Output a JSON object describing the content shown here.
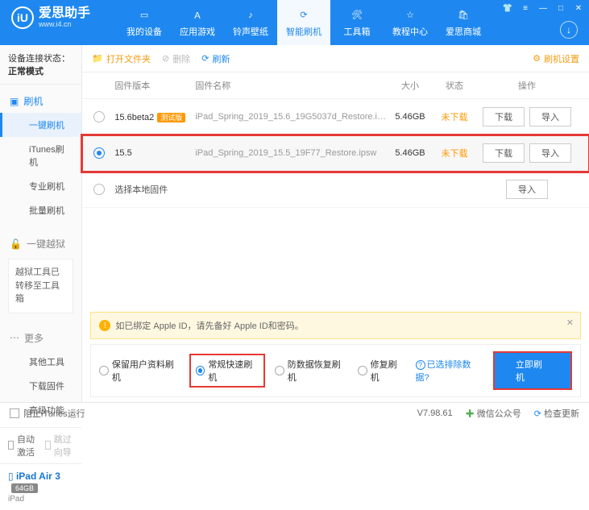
{
  "brand": {
    "name": "爱思助手",
    "sub": "www.i4.cn",
    "logo_letter": "iU"
  },
  "nav": [
    {
      "icon": "phone",
      "label": "我的设备"
    },
    {
      "icon": "apps",
      "label": "应用游戏"
    },
    {
      "icon": "music",
      "label": "铃声壁纸"
    },
    {
      "icon": "flash",
      "label": "智能刷机"
    },
    {
      "icon": "toolbox",
      "label": "工具箱"
    },
    {
      "icon": "help",
      "label": "教程中心"
    },
    {
      "icon": "shop",
      "label": "爱思商城"
    }
  ],
  "sidebar": {
    "status_label": "设备连接状态：",
    "status_value": "正常模式",
    "sections": {
      "flash": {
        "label": "刷机",
        "items": [
          "一键刷机",
          "iTunes刷机",
          "专业刷机",
          "批量刷机"
        ]
      },
      "jailbreak": {
        "label": "一键越狱",
        "note": "越狱工具已转移至工具箱"
      },
      "more": {
        "label": "更多",
        "items": [
          "其他工具",
          "下载固件",
          "高级功能"
        ]
      }
    },
    "auto_activate": "自动激活",
    "skip_guide": "跳过向导",
    "device": {
      "name": "iPad Air 3",
      "badge": "64GB",
      "sub": "iPad"
    }
  },
  "toolbar": {
    "open_folder": "打开文件夹",
    "delete": "删除",
    "refresh": "刷新",
    "settings": "刷机设置"
  },
  "columns": {
    "version": "固件版本",
    "name": "固件名称",
    "size": "大小",
    "state": "状态",
    "op": "操作"
  },
  "firmware": [
    {
      "version": "15.6beta2",
      "beta_tag": "测试版",
      "name": "iPad_Spring_2019_15.6_19G5037d_Restore.i…",
      "size": "5.46GB",
      "state": "未下载",
      "selected": false
    },
    {
      "version": "15.5",
      "name": "iPad_Spring_2019_15.5_19F77_Restore.ipsw",
      "size": "5.46GB",
      "state": "未下载",
      "selected": true
    }
  ],
  "local_row": "选择本地固件",
  "btn": {
    "download": "下载",
    "import": "导入"
  },
  "alert": {
    "icon": "!",
    "text": "如已绑定 Apple ID，请先备好 Apple ID和密码。"
  },
  "options": {
    "keep_data": "保留用户资料刷机",
    "normal": "常规快速刷机",
    "anti_recovery": "防数据恢复刷机",
    "repair": "修复刷机",
    "exclude_link": "已选排除数据?",
    "go": "立即刷机"
  },
  "statusbar": {
    "block_itunes": "阻止iTunes运行",
    "version": "V7.98.61",
    "wechat": "微信公众号",
    "check_update": "检查更新"
  }
}
